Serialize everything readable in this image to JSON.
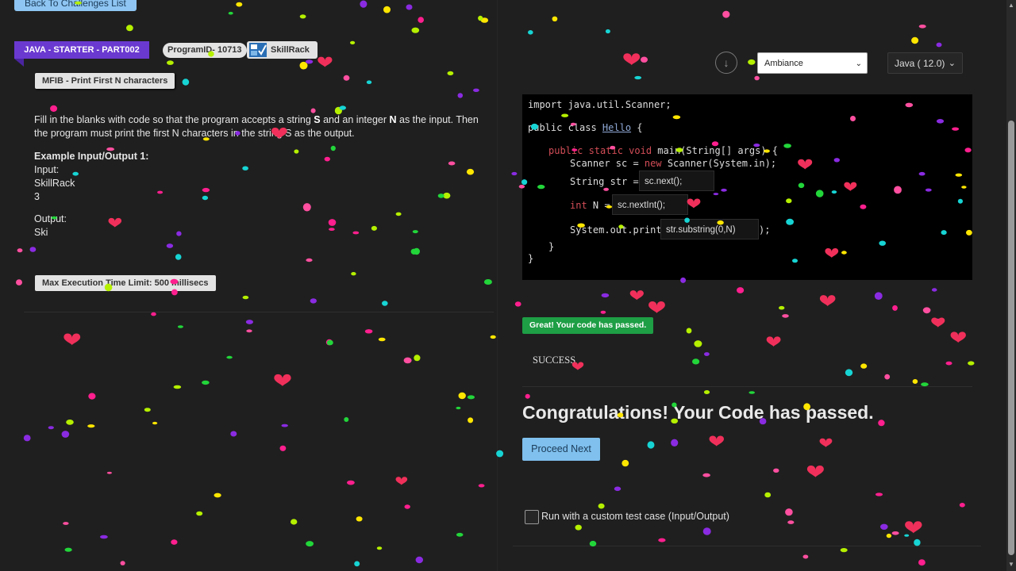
{
  "left": {
    "back_button": "Back To Challenges List",
    "track": "JAVA - STARTER - PART002",
    "program_id": "ProgramID- 10713",
    "brand": "SkillRack",
    "problem_title": "MFIB - Print First N characters",
    "description_parts": {
      "p1": "Fill in the blanks with code so that the program accepts a string ",
      "s": "S",
      "p2": " and an integer ",
      "n": "N",
      "p3": " as the input. Then the program must print the first N characters in the string S as the output."
    },
    "example": {
      "heading": "Example Input/Output 1:",
      "input_label": "Input:",
      "input_line1": "SkillRack",
      "input_line2": "3",
      "output_label": "Output:",
      "output_value": "Ski"
    },
    "time_limit": "Max Execution Time Limit: 500 millisecs"
  },
  "right": {
    "theme_select": "Ambiance",
    "language_select": "Java ( 12.0)",
    "code": {
      "line1": "import java.util.Scanner;",
      "line2_kw": "public class ",
      "line2_cls": "Hello",
      "line2_end": " {",
      "line3_kw": "public static void ",
      "line3_rest": "main(String[] args) {",
      "line4_a": "Scanner sc = ",
      "line4_kw": "new",
      "line4_b": " Scanner(System.in);",
      "line5_a": "String str = ",
      "blank1": "sc.next();",
      "line6_kw": "int",
      "line6_a": " N = ",
      "blank2": "sc.nextInt();",
      "line7_a": "System.out.print(",
      "blank3": "str.substring(0,N)",
      "line7_end": ");",
      "line8": "}",
      "line9": "}"
    },
    "pass_badge": "Great! Your code has passed.",
    "result_text": "SUCCESS",
    "congrats": "Congratulations! Your Code has passed.",
    "proceed_button": "Proceed Next",
    "custom_test_label": "Run with a custom test case (Input/Output)"
  },
  "icons": {
    "download": "arrow-down-circle-icon",
    "select_chevron": "chevron-down-icon"
  },
  "colors": {
    "background": "#1f1f1f",
    "accent_purple": "#6a39d0",
    "success_green": "#1e9e45",
    "button_blue": "#7fc0ee"
  },
  "confetti_colors": [
    "#ff1f8e",
    "#b5f000",
    "#ffe600",
    "#17d4d4",
    "#8a2be2",
    "#22d63a",
    "#ff4fa0"
  ]
}
